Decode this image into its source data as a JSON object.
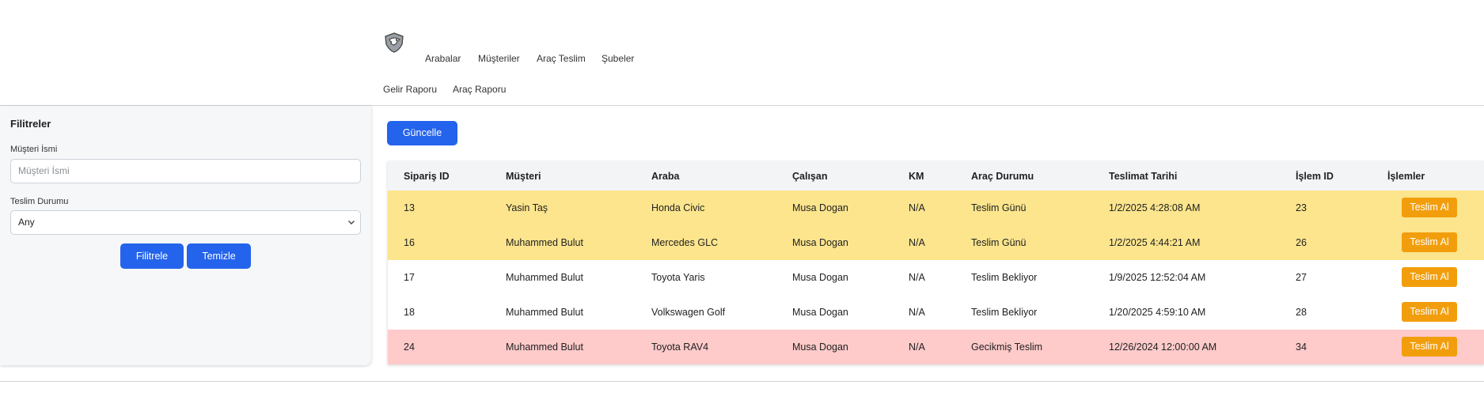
{
  "header": {
    "logo_icon": "eagle-shield-logo",
    "nav_row1": [
      "Arabalar",
      "Müşteriler",
      "Araç Teslim",
      "Şubeler"
    ],
    "nav_row2": [
      "Gelir Raporu",
      "Araç Raporu"
    ]
  },
  "sidebar": {
    "title": "Filitreler",
    "customer_label": "Müşteri İsmi",
    "customer_placeholder": "Müşteri İsmi",
    "status_label": "Teslim Durumu",
    "status_selected": "Any",
    "filter_button": "Filitrele",
    "clear_button": "Temizle"
  },
  "main": {
    "update_button": "Güncelle",
    "columns": [
      "Sipariş ID",
      "Müşteri",
      "Araba",
      "Çalışan",
      "KM",
      "Araç Durumu",
      "Teslimat Tarihi",
      "İşlem ID",
      "İşlemler"
    ],
    "action_label": "Teslim Al",
    "rows": [
      {
        "siparis_id": "13",
        "musteri": "Yasin Taş",
        "araba": "Honda Civic",
        "calisan": "Musa Dogan",
        "km": "N/A",
        "durum": "Teslim Günü",
        "tarih": "1/2/2025 4:28:08 AM",
        "islem_id": "23"
      },
      {
        "siparis_id": "16",
        "musteri": "Muhammed Bulut",
        "araba": "Mercedes GLC",
        "calisan": "Musa Dogan",
        "km": "N/A",
        "durum": "Teslim Günü",
        "tarih": "1/2/2025 4:44:21 AM",
        "islem_id": "26"
      },
      {
        "siparis_id": "17",
        "musteri": "Muhammed Bulut",
        "araba": "Toyota Yaris",
        "calisan": "Musa Dogan",
        "km": "N/A",
        "durum": "Teslim Bekliyor",
        "tarih": "1/9/2025 12:52:04 AM",
        "islem_id": "27"
      },
      {
        "siparis_id": "18",
        "musteri": "Muhammed Bulut",
        "araba": "Volkswagen Golf",
        "calisan": "Musa Dogan",
        "km": "N/A",
        "durum": "Teslim Bekliyor",
        "tarih": "1/20/2025 4:59:10 AM",
        "islem_id": "28"
      },
      {
        "siparis_id": "24",
        "musteri": "Muhammed Bulut",
        "araba": "Toyota RAV4",
        "calisan": "Musa Dogan",
        "km": "N/A",
        "durum": "Gecikmiş Teslim",
        "tarih": "12/26/2024 12:00:00 AM",
        "islem_id": "34"
      }
    ]
  },
  "colors": {
    "primary_button": "#2463eb",
    "action_button": "#f29e0c",
    "row_due_today": "#fce58d",
    "row_waiting": "#ffffff",
    "row_overdue": "#fecaca"
  }
}
